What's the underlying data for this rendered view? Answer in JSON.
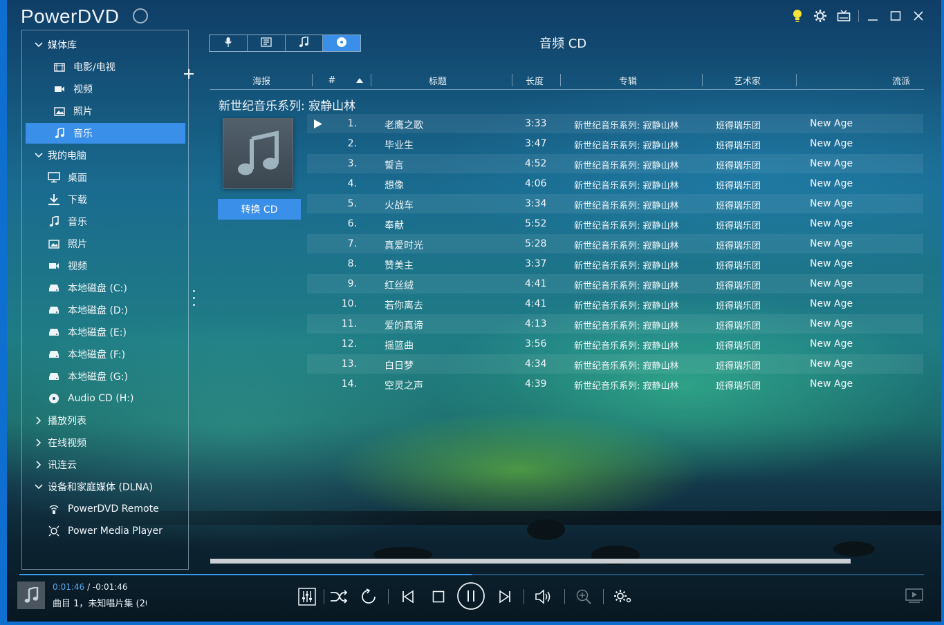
{
  "app": {
    "title": "PowerDVD"
  },
  "sidebar": {
    "media_library": "媒体库",
    "library_items": [
      "电影/电视",
      "视频",
      "照片",
      "音乐"
    ],
    "my_computer": "我的电脑",
    "computer_items": [
      "桌面",
      "下载",
      "音乐",
      "照片",
      "视频",
      "本地磁盘 (C:)",
      "本地磁盘 (D:)",
      "本地磁盘 (E:)",
      "本地磁盘 (F:)",
      "本地磁盘 (G:)",
      "Audio CD (H:)"
    ],
    "playlists": "播放列表",
    "online_video": "在线视频",
    "cloud": "讯连云",
    "dlna": "设备和家庭媒体 (DLNA)",
    "dlna_items": [
      "PowerDVD Remote",
      "Power Media Player"
    ]
  },
  "view": {
    "title": "音频 CD"
  },
  "columns": {
    "poster": "海报",
    "number": "#",
    "title": "标题",
    "length": "长度",
    "album": "专辑",
    "artist": "艺术家",
    "genre": "流派"
  },
  "album": {
    "title": "新世纪音乐系列: 寂静山林",
    "convert_button": "转换 CD"
  },
  "tracks": [
    {
      "num": "1.",
      "title": "老鹰之歌",
      "length": "3:33",
      "album": "新世纪音乐系列: 寂静山林",
      "artist": "班得瑞乐团",
      "genre": "New Age"
    },
    {
      "num": "2.",
      "title": "毕业生",
      "length": "3:47",
      "album": "新世纪音乐系列: 寂静山林",
      "artist": "班得瑞乐团",
      "genre": "New Age"
    },
    {
      "num": "3.",
      "title": "誓言",
      "length": "4:52",
      "album": "新世纪音乐系列: 寂静山林",
      "artist": "班得瑞乐团",
      "genre": "New Age"
    },
    {
      "num": "4.",
      "title": "想像",
      "length": "4:06",
      "album": "新世纪音乐系列: 寂静山林",
      "artist": "班得瑞乐团",
      "genre": "New Age"
    },
    {
      "num": "5.",
      "title": "火战车",
      "length": "3:34",
      "album": "新世纪音乐系列: 寂静山林",
      "artist": "班得瑞乐团",
      "genre": "New Age"
    },
    {
      "num": "6.",
      "title": "奉献",
      "length": "5:52",
      "album": "新世纪音乐系列: 寂静山林",
      "artist": "班得瑞乐团",
      "genre": "New Age"
    },
    {
      "num": "7.",
      "title": "真爱时光",
      "length": "5:28",
      "album": "新世纪音乐系列: 寂静山林",
      "artist": "班得瑞乐团",
      "genre": "New Age"
    },
    {
      "num": "8.",
      "title": "赞美主",
      "length": "3:37",
      "album": "新世纪音乐系列: 寂静山林",
      "artist": "班得瑞乐团",
      "genre": "New Age"
    },
    {
      "num": "9.",
      "title": "红丝绒",
      "length": "4:41",
      "album": "新世纪音乐系列: 寂静山林",
      "artist": "班得瑞乐团",
      "genre": "New Age"
    },
    {
      "num": "10.",
      "title": "若你离去",
      "length": "4:41",
      "album": "新世纪音乐系列: 寂静山林",
      "artist": "班得瑞乐团",
      "genre": "New Age"
    },
    {
      "num": "11.",
      "title": "爱的真谛",
      "length": "4:13",
      "album": "新世纪音乐系列: 寂静山林",
      "artist": "班得瑞乐团",
      "genre": "New Age"
    },
    {
      "num": "12.",
      "title": "摇篮曲",
      "length": "3:56",
      "album": "新世纪音乐系列: 寂静山林",
      "artist": "班得瑞乐团",
      "genre": "New Age"
    },
    {
      "num": "13.",
      "title": "白日梦",
      "length": "4:34",
      "album": "新世纪音乐系列: 寂静山林",
      "artist": "班得瑞乐团",
      "genre": "New Age"
    },
    {
      "num": "14.",
      "title": "空灵之声",
      "length": "4:39",
      "album": "新世纪音乐系列: 寂静山林",
      "artist": "班得瑞乐团",
      "genre": "New Age"
    }
  ],
  "playback": {
    "progress_percent": 50,
    "current_time": "0:01:46",
    "remaining_time": "-0:01:46",
    "separator": "/",
    "now_playing": "曲目 1，未知唱片集 (20"
  },
  "colors": {
    "accent": "#3a8fe8",
    "bulb": "#f6e23a"
  }
}
